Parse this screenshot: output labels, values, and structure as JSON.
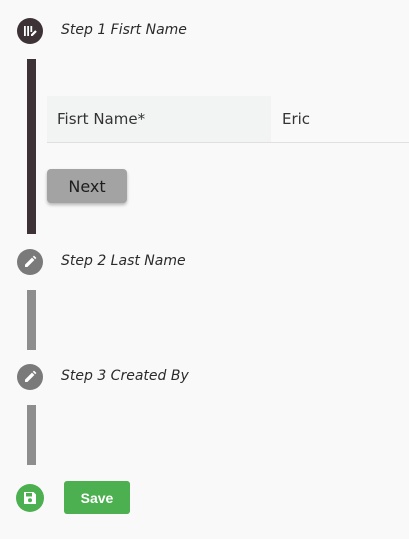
{
  "steps": [
    {
      "label": "Step 1 Fisrt Name",
      "icon": "edit-note-icon",
      "active": true
    },
    {
      "label": "Step 2 Last Name",
      "icon": "pencil-icon",
      "active": false
    },
    {
      "label": "Step 3 Created By",
      "icon": "pencil-icon",
      "active": false
    }
  ],
  "form": {
    "field_label": "Fisrt Name*",
    "field_value": "Eric",
    "next_label": "Next"
  },
  "footer": {
    "save_icon": "floppy-disk-icon",
    "save_label": "Save"
  },
  "colors": {
    "active_step": "#3d3235",
    "inactive_step": "#7a7a7a",
    "save_green": "#4caf50",
    "next_button": "#a3a3a3"
  }
}
